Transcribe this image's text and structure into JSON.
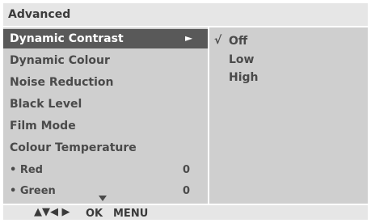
{
  "header": {
    "title": "Advanced"
  },
  "menu": {
    "items": [
      {
        "label": "Dynamic Contrast",
        "selected": true,
        "arrow": "►"
      },
      {
        "label": "Dynamic Colour"
      },
      {
        "label": "Noise Reduction"
      },
      {
        "label": "Black Level"
      },
      {
        "label": "Film Mode"
      },
      {
        "label": "Colour Temperature"
      }
    ],
    "sub_items": [
      {
        "label": "• Red",
        "value": "0"
      },
      {
        "label": "• Green",
        "value": "0"
      }
    ],
    "scroll_more": "down-arrow-icon"
  },
  "options": {
    "check_mark": "√",
    "items": [
      {
        "label": "Off",
        "selected": true
      },
      {
        "label": "Low"
      },
      {
        "label": "High"
      }
    ]
  },
  "footer": {
    "nav_arrows": "▲▼◀ ▶",
    "ok_label": "OK",
    "menu_label": "MENU"
  },
  "colors": {
    "panel_bg": "#cfcfcf",
    "title_bg": "#e6e6e6",
    "selected_bg": "#595959",
    "text": "#4a4a4a"
  }
}
